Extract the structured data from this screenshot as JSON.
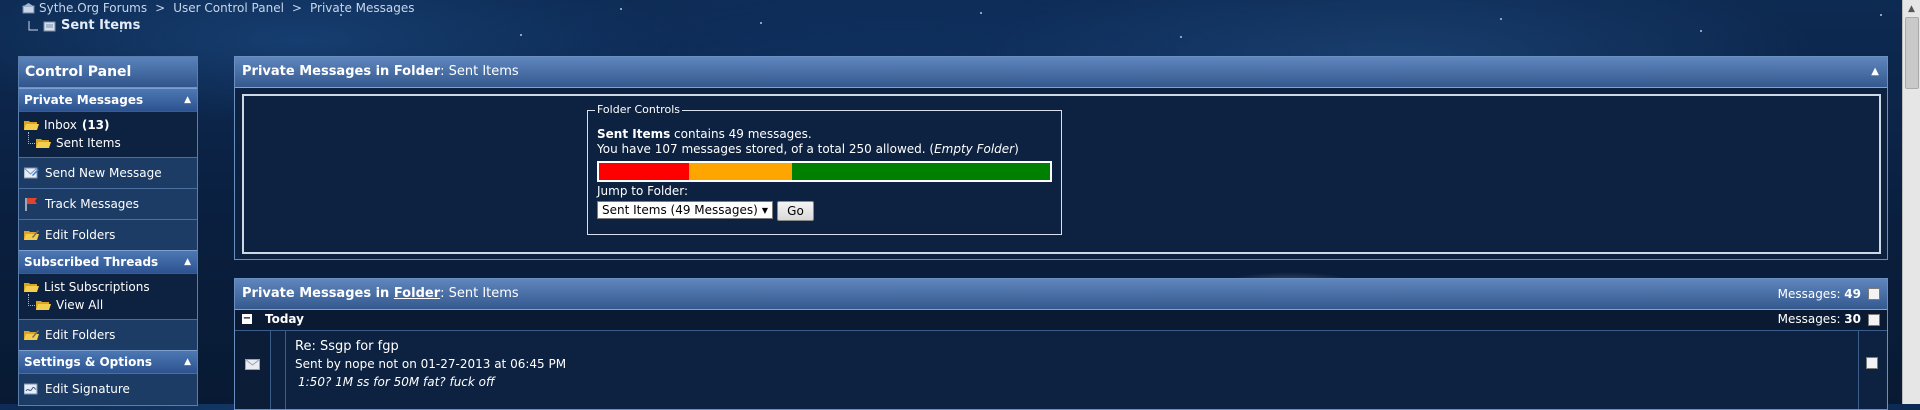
{
  "breadcrumb": {
    "items": [
      "Sythe.Org Forums",
      "User Control Panel",
      "Private Messages"
    ],
    "separator": ">",
    "current": "Sent Items"
  },
  "sidebar": {
    "title": "Control Panel",
    "sections": {
      "private_messages": {
        "label": "Private Messages",
        "inbox_label": "Inbox",
        "inbox_count": "(13)",
        "sent_label": "Sent Items",
        "items": [
          "Send New Message",
          "Track Messages",
          "Edit Folders"
        ]
      },
      "subscribed_threads": {
        "label": "Subscribed Threads",
        "list_label": "List Subscriptions",
        "view_all": "View All",
        "items": [
          "Edit Folders"
        ]
      },
      "settings": {
        "label": "Settings & Options",
        "items": [
          "Edit Signature"
        ]
      }
    }
  },
  "folder_panel": {
    "title_bold": "Private Messages in Folder",
    "title_rest": ": Sent Items",
    "legend": "Folder Controls",
    "folder_name": "Sent Items",
    "contains_text": " contains 49 messages.",
    "stored_text_pre": "You have 107 messages stored, of a total 250 allowed. (",
    "empty_folder": "Empty Folder",
    "stored_text_post": ")",
    "usage_segments": [
      {
        "color": "#ff0000",
        "fraction": 0.2
      },
      {
        "color": "#ffa500",
        "fraction": 0.228
      },
      {
        "color": "#008000",
        "fraction": 0.572
      }
    ],
    "jump_label": "Jump to Folder:",
    "jump_selected": "Sent Items (49 Messages)",
    "go_label": "Go"
  },
  "list_panel": {
    "title_bold_pre": "Private Messages in ",
    "title_link": "Folder",
    "title_rest": ": Sent Items",
    "messages_label": "Messages: ",
    "messages_count": "49",
    "group": {
      "toggle": "−",
      "label": "Today",
      "count_label": "Messages: ",
      "count": "30"
    },
    "messages": [
      {
        "title": "Re: Ssgp for fgp",
        "meta": "Sent by nope not on 01-27-2013 at 06:45 PM",
        "preview": "1:50? 1M ss for 50M fat? fuck off"
      }
    ]
  },
  "colors": {
    "header_blue": "#4d78b3",
    "panel_bg": "#0d2140",
    "accent_border": "#6a8fc0"
  }
}
